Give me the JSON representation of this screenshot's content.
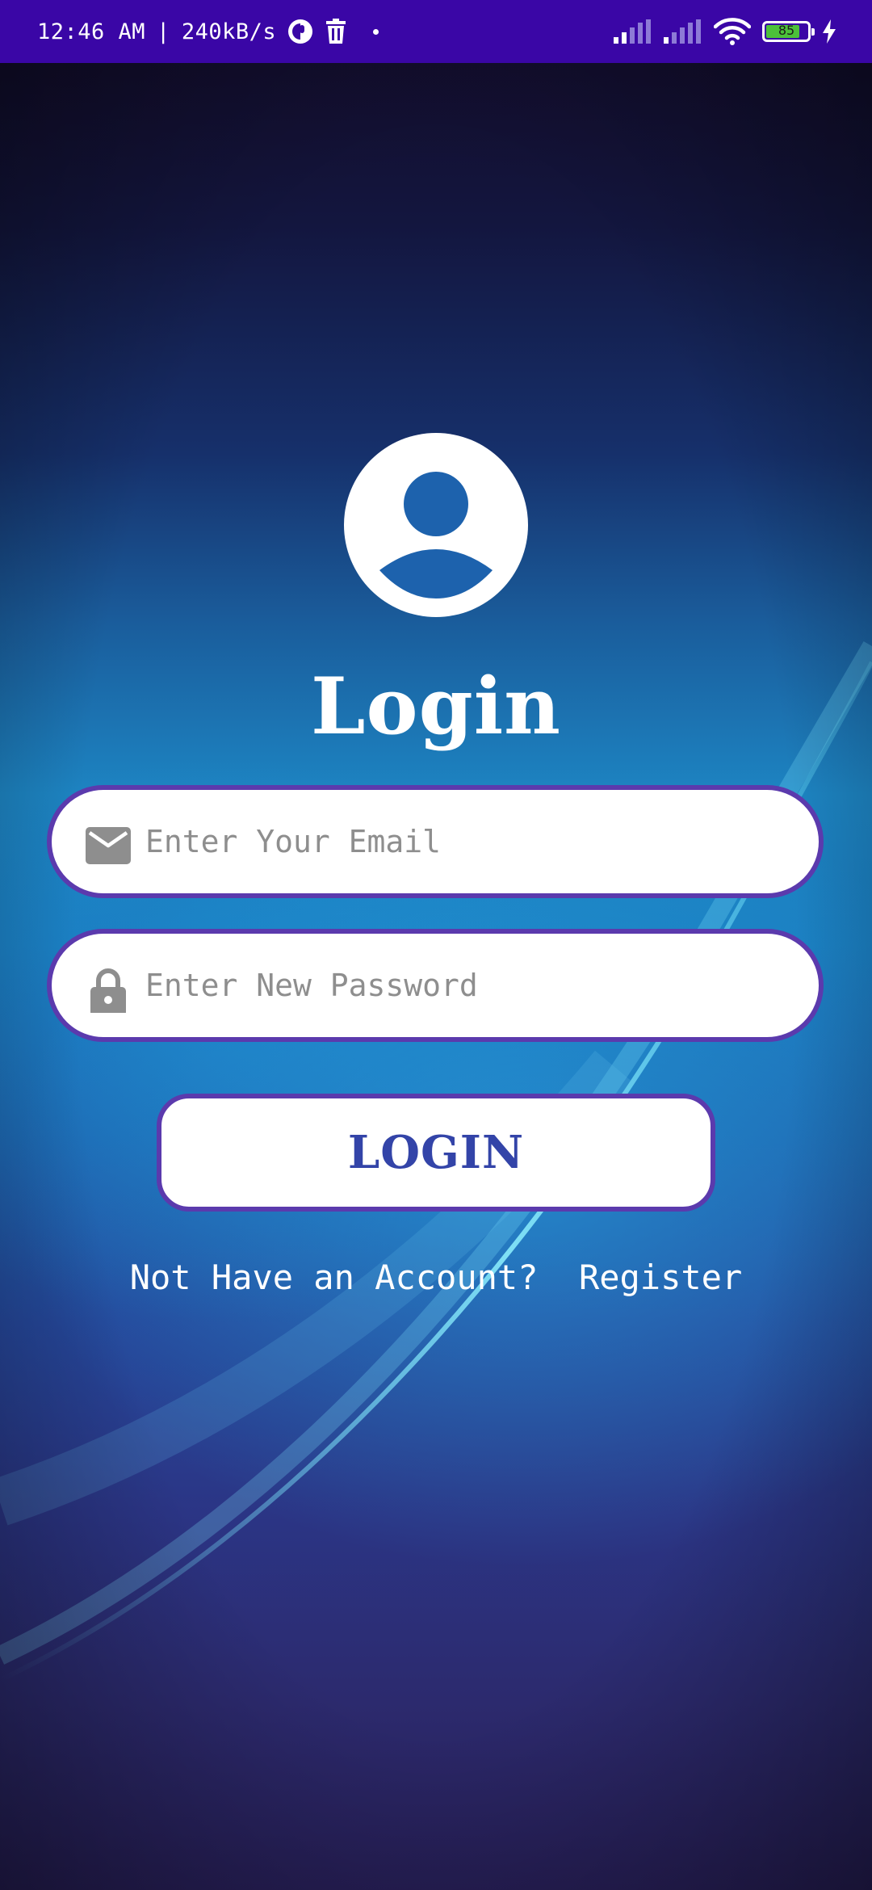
{
  "status_bar": {
    "time": "12:46 AM",
    "separator": "|",
    "speed": "240kB/s",
    "battery_level": "85",
    "battery_fraction": 0.85,
    "icons": [
      "cast-icon",
      "trash-icon",
      "signal-icon",
      "signal-icon",
      "wifi-icon",
      "battery-icon",
      "charging-icon"
    ]
  },
  "login": {
    "title": "Login",
    "email": {
      "placeholder": "Enter Your Email",
      "value": "",
      "icon": "mail-icon"
    },
    "password": {
      "placeholder": "Enter New Password",
      "value": "",
      "icon": "lock-icon"
    },
    "button_label": "LOGIN",
    "register_prompt": "Not Have an Account?",
    "register_link": "Register"
  },
  "colors": {
    "status_bar": "#3a06a6",
    "field_border": "#5b3aad",
    "button_text": "#3344a8",
    "icon_gray": "#8e8e8e"
  }
}
